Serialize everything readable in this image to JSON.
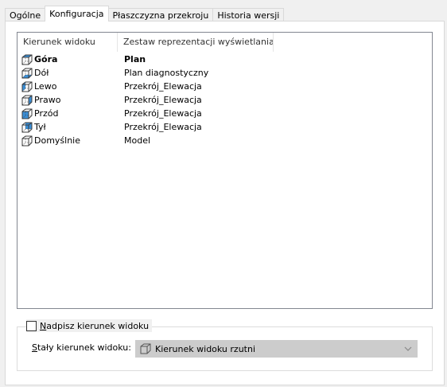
{
  "tabs": [
    {
      "label": "Ogólne",
      "active": false
    },
    {
      "label": "Konfiguracja",
      "active": true
    },
    {
      "label": "Płaszczyzna przekroju",
      "active": false
    },
    {
      "label": "Historia wersji",
      "active": false
    }
  ],
  "list": {
    "columns": [
      "Kierunek widoku",
      "Zestaw reprezentacji wyświetlania"
    ],
    "rows": [
      {
        "direction": "Góra",
        "display_set": "Plan",
        "bold": true,
        "icon": "view-top-icon"
      },
      {
        "direction": "Dół",
        "display_set": "Plan diagnostyczny",
        "bold": false,
        "icon": "view-bottom-icon"
      },
      {
        "direction": "Lewo",
        "display_set": "Przekrój_Elewacja",
        "bold": false,
        "icon": "view-left-icon"
      },
      {
        "direction": "Prawo",
        "display_set": "Przekrój_Elewacja",
        "bold": false,
        "icon": "view-right-icon"
      },
      {
        "direction": "Przód",
        "display_set": "Przekrój_Elewacja",
        "bold": false,
        "icon": "view-front-icon"
      },
      {
        "direction": "Tył",
        "display_set": "Przekrój_Elewacja",
        "bold": false,
        "icon": "view-back-icon"
      },
      {
        "direction": "Domyślnie",
        "display_set": "Model",
        "bold": false,
        "icon": "view-default-icon"
      }
    ]
  },
  "override": {
    "checkbox_label_underlined": "N",
    "checkbox_label_rest": "adpisz kierunek widoku",
    "checked": false
  },
  "fixed_direction": {
    "label_underlined": "S",
    "label_rest": "tały kierunek widoku:",
    "value": "Kierunek widoku rzutni",
    "disabled": true
  },
  "colors": {
    "icon_face": "#3a8fd8",
    "icon_edge": "#3c3c3c",
    "combo_bg": "#cccccc"
  }
}
